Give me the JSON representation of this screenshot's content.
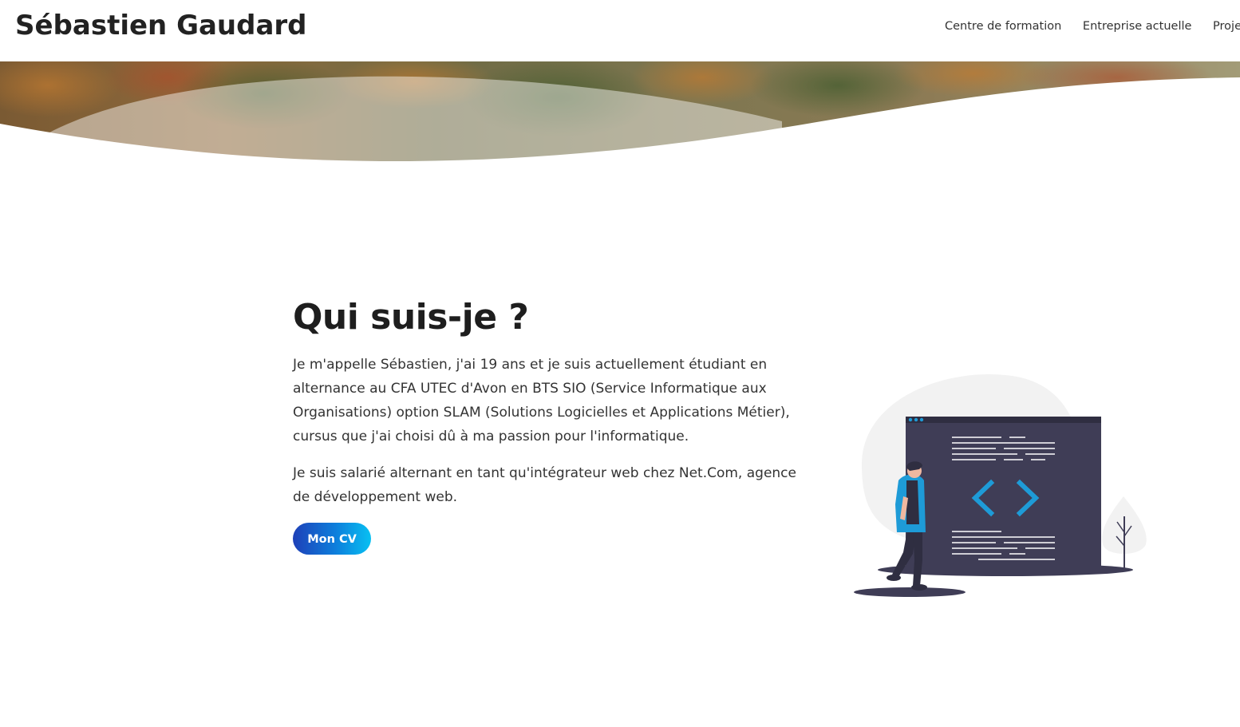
{
  "navbar": {
    "brand": "Sébastien Gaudard",
    "links": [
      "Centre de formation",
      "Entreprise actuelle",
      "Projets"
    ]
  },
  "about": {
    "title": "Qui suis-je ?",
    "paragraph1": "Je m'appelle Sébastien, j'ai 19 ans et je suis actuellement étudiant en alternance au CFA UTEC d'Avon en BTS SIO (Service Informatique aux Organisations) option SLAM (Solutions Logicielles et Applications Métier), cursus que j'ai choisi dû à ma passion pour l'informatique.",
    "paragraph2": "Je suis salarié alternant en tant qu'intégrateur web chez Net.Com, agence de développement web.",
    "cv_button": "Mon CV"
  },
  "colors": {
    "accent_start": "#1e40b8",
    "accent_end": "#08c0f2",
    "illustration_dark": "#3f3d56",
    "illustration_blue": "#1e9bd7"
  },
  "icons": {
    "code": "code-brackets-icon"
  }
}
